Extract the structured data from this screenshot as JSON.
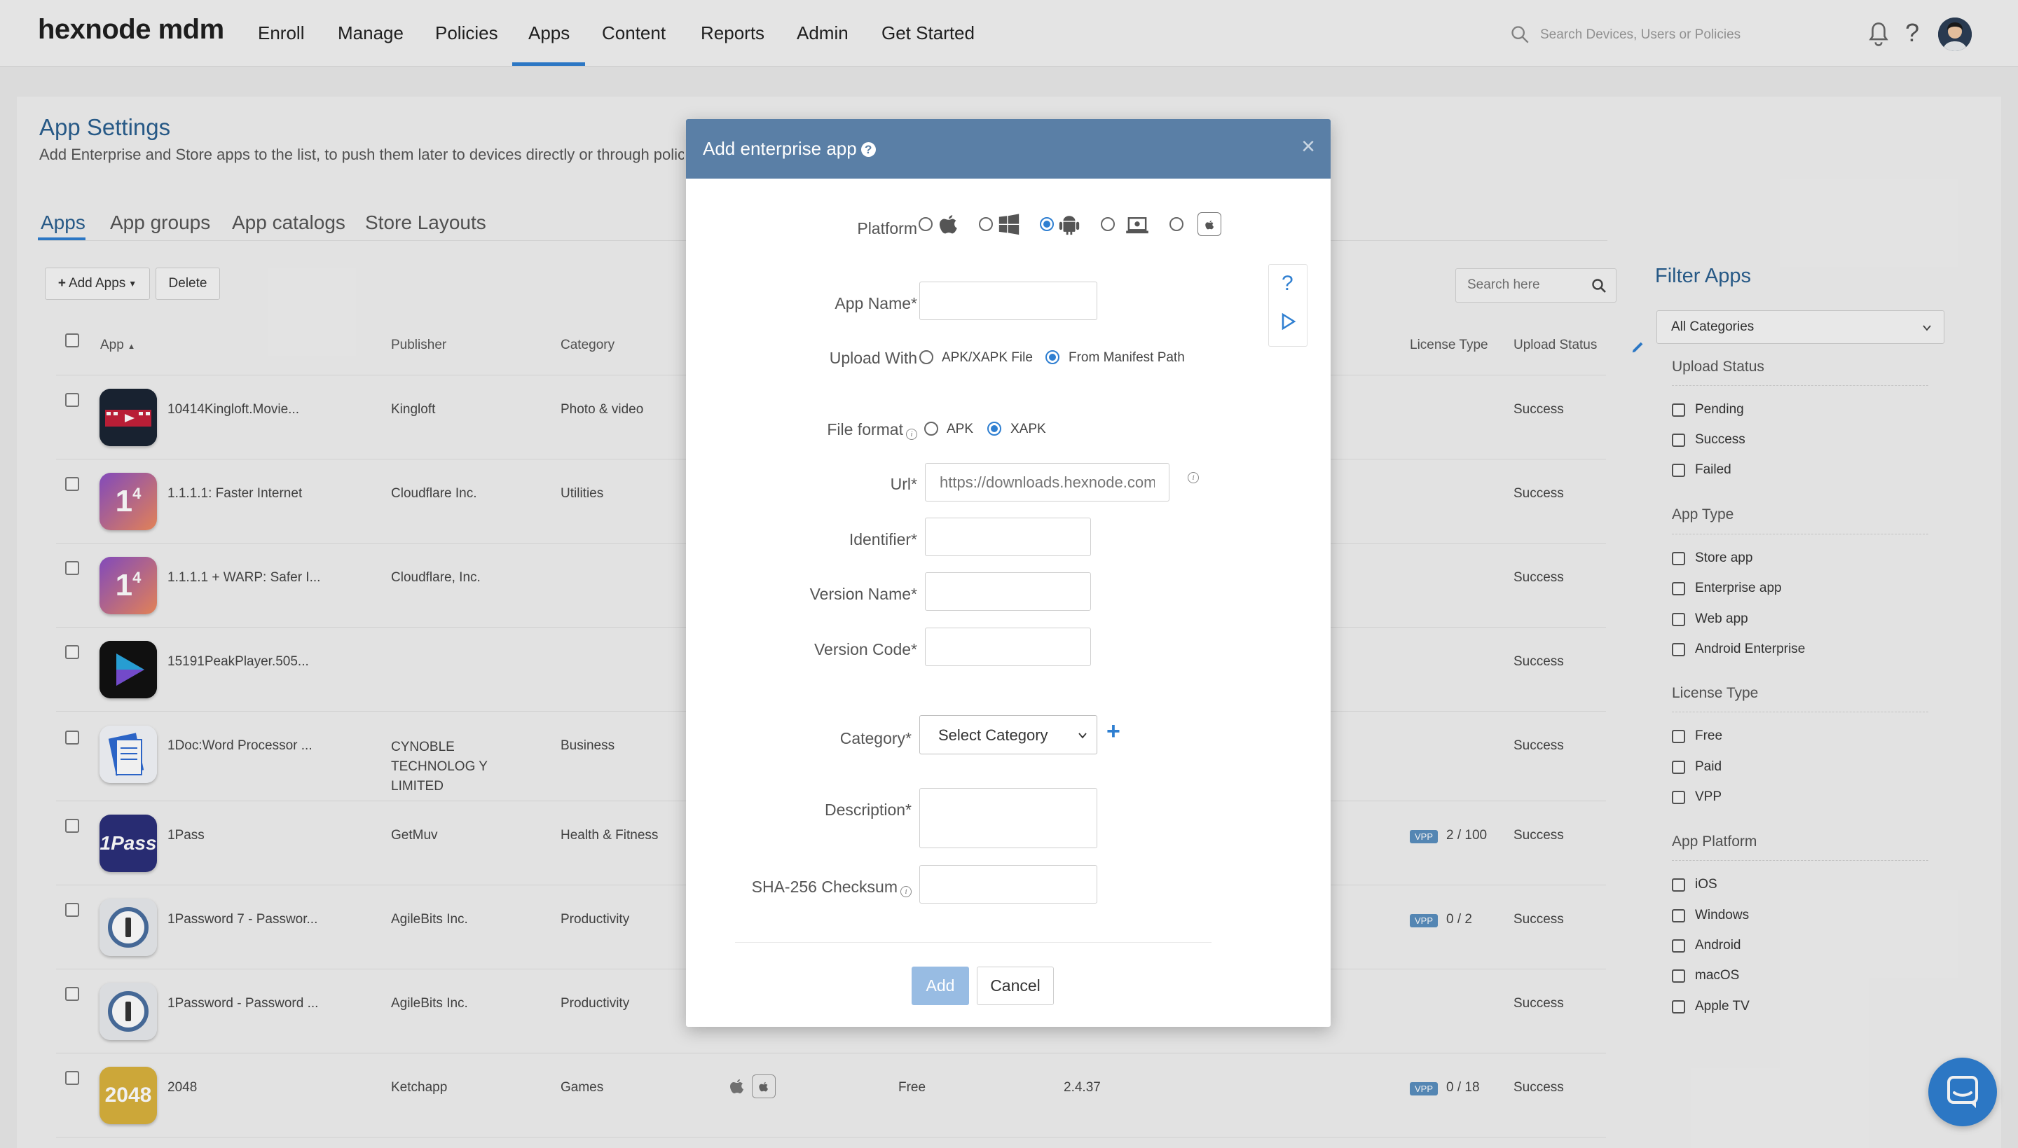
{
  "app": {
    "logo": "hexnode mdm",
    "nav": [
      "Enroll",
      "Manage",
      "Policies",
      "Apps",
      "Content",
      "Reports",
      "Admin",
      "Get Started"
    ],
    "active_nav": "Apps",
    "search_placeholder": "Search Devices, Users or Policies"
  },
  "page": {
    "title": "App Settings",
    "subtitle": "Add Enterprise and Store apps to the list, to push them later to devices directly or through polic",
    "tabs": [
      "Apps",
      "App groups",
      "App catalogs",
      "Store Layouts"
    ],
    "active_tab": "Apps",
    "add_apps_label": "Add Apps",
    "delete_label": "Delete",
    "search_placeholder": "Search here"
  },
  "table": {
    "headers": {
      "app": "App",
      "publisher": "Publisher",
      "category": "Category",
      "license_type": "License Type",
      "upload_status": "Upload Status"
    },
    "rows": [
      {
        "name": "10414Kingloft.Movie...",
        "publisher": "Kingloft",
        "category": "Photo & video",
        "license": "",
        "price": "",
        "version": "",
        "status": "Success",
        "icon": "movie-icon"
      },
      {
        "name": "1.1.1.1: Faster Internet",
        "publisher": "Cloudflare Inc.",
        "category": "Utilities",
        "license": "",
        "price": "",
        "version": "",
        "status": "Success",
        "icon": "cloudflare-1-icon"
      },
      {
        "name": "1.1.1.1 + WARP: Safer I...",
        "publisher": "Cloudflare, Inc.",
        "category": "",
        "license": "",
        "price": "",
        "version": "",
        "status": "Success",
        "icon": "cloudflare-1-icon"
      },
      {
        "name": "15191PeakPlayer.505...",
        "publisher": "",
        "category": "",
        "license": "",
        "price": "",
        "version": "",
        "status": "Success",
        "icon": "play-icon"
      },
      {
        "name": "1Doc:Word Processor ...",
        "publisher": "CYNOBLE TECHNOLOG Y LIMITED",
        "category": "Business",
        "license": "",
        "price": "",
        "version": "",
        "status": "Success",
        "icon": "document-icon"
      },
      {
        "name": "1Pass",
        "publisher": "GetMuv",
        "category": "Health & Fitness",
        "license": "2 / 100",
        "price": "",
        "version": "",
        "status": "Success",
        "icon": "1pass-icon"
      },
      {
        "name": "1Password 7 - Passwor...",
        "publisher": "AgileBits Inc.",
        "category": "Productivity",
        "license": "0 / 2",
        "price": "",
        "version": "",
        "status": "Success",
        "icon": "1password-icon"
      },
      {
        "name": "1Password - Password ...",
        "publisher": "AgileBits Inc.",
        "category": "Productivity",
        "license": "",
        "price": "",
        "version": "",
        "status": "Success",
        "icon": "1password-icon"
      },
      {
        "name": "2048",
        "publisher": "Ketchapp",
        "category": "Games",
        "license": "0 / 18",
        "price": "Free",
        "version": "2.4.37",
        "status": "Success",
        "icon": "2048-icon"
      }
    ],
    "vpp_badge": "VPP",
    "icon_2048_text": "2048",
    "icon_1pass_text": "1Pass"
  },
  "filter": {
    "title": "Filter Apps",
    "category_select": "All Categories",
    "groups": [
      {
        "title": "Upload Status",
        "options": [
          "Pending",
          "Success",
          "Failed"
        ]
      },
      {
        "title": "App Type",
        "options": [
          "Store app",
          "Enterprise app",
          "Web app",
          "Android Enterprise"
        ]
      },
      {
        "title": "License Type",
        "options": [
          "Free",
          "Paid",
          "VPP"
        ]
      },
      {
        "title": "App Platform",
        "options": [
          "iOS",
          "Windows",
          "Android",
          "macOS",
          "Apple TV"
        ]
      }
    ]
  },
  "modal": {
    "title": "Add enterprise app",
    "platform_label": "Platform",
    "platforms": [
      "apple-icon",
      "windows-icon",
      "android-icon",
      "chromebook-icon",
      "apple-tv-icon"
    ],
    "selected_platform": "android-icon",
    "app_name_label": "App Name*",
    "upload_with_label": "Upload With",
    "upload_options": [
      "APK/XAPK File",
      "From Manifest Path"
    ],
    "upload_selected": "From Manifest Path",
    "file_format_label": "File format",
    "file_format_options": [
      "APK",
      "XAPK"
    ],
    "file_format_selected": "XAPK",
    "url_label": "Url*",
    "url_placeholder": "https://downloads.hexnode.com",
    "identifier_label": "Identifier*",
    "version_name_label": "Version Name*",
    "version_code_label": "Version Code*",
    "category_label": "Category*",
    "category_select": "Select Category",
    "description_label": "Description*",
    "checksum_label": "SHA-256 Checksum",
    "add_label": "Add",
    "cancel_label": "Cancel",
    "close": "×"
  },
  "colors": {
    "accent": "#2f7fd1",
    "modal_header": "#5a7fa6",
    "title_blue": "#2a5f8f",
    "vpp_badge": "#5a8fbf"
  }
}
